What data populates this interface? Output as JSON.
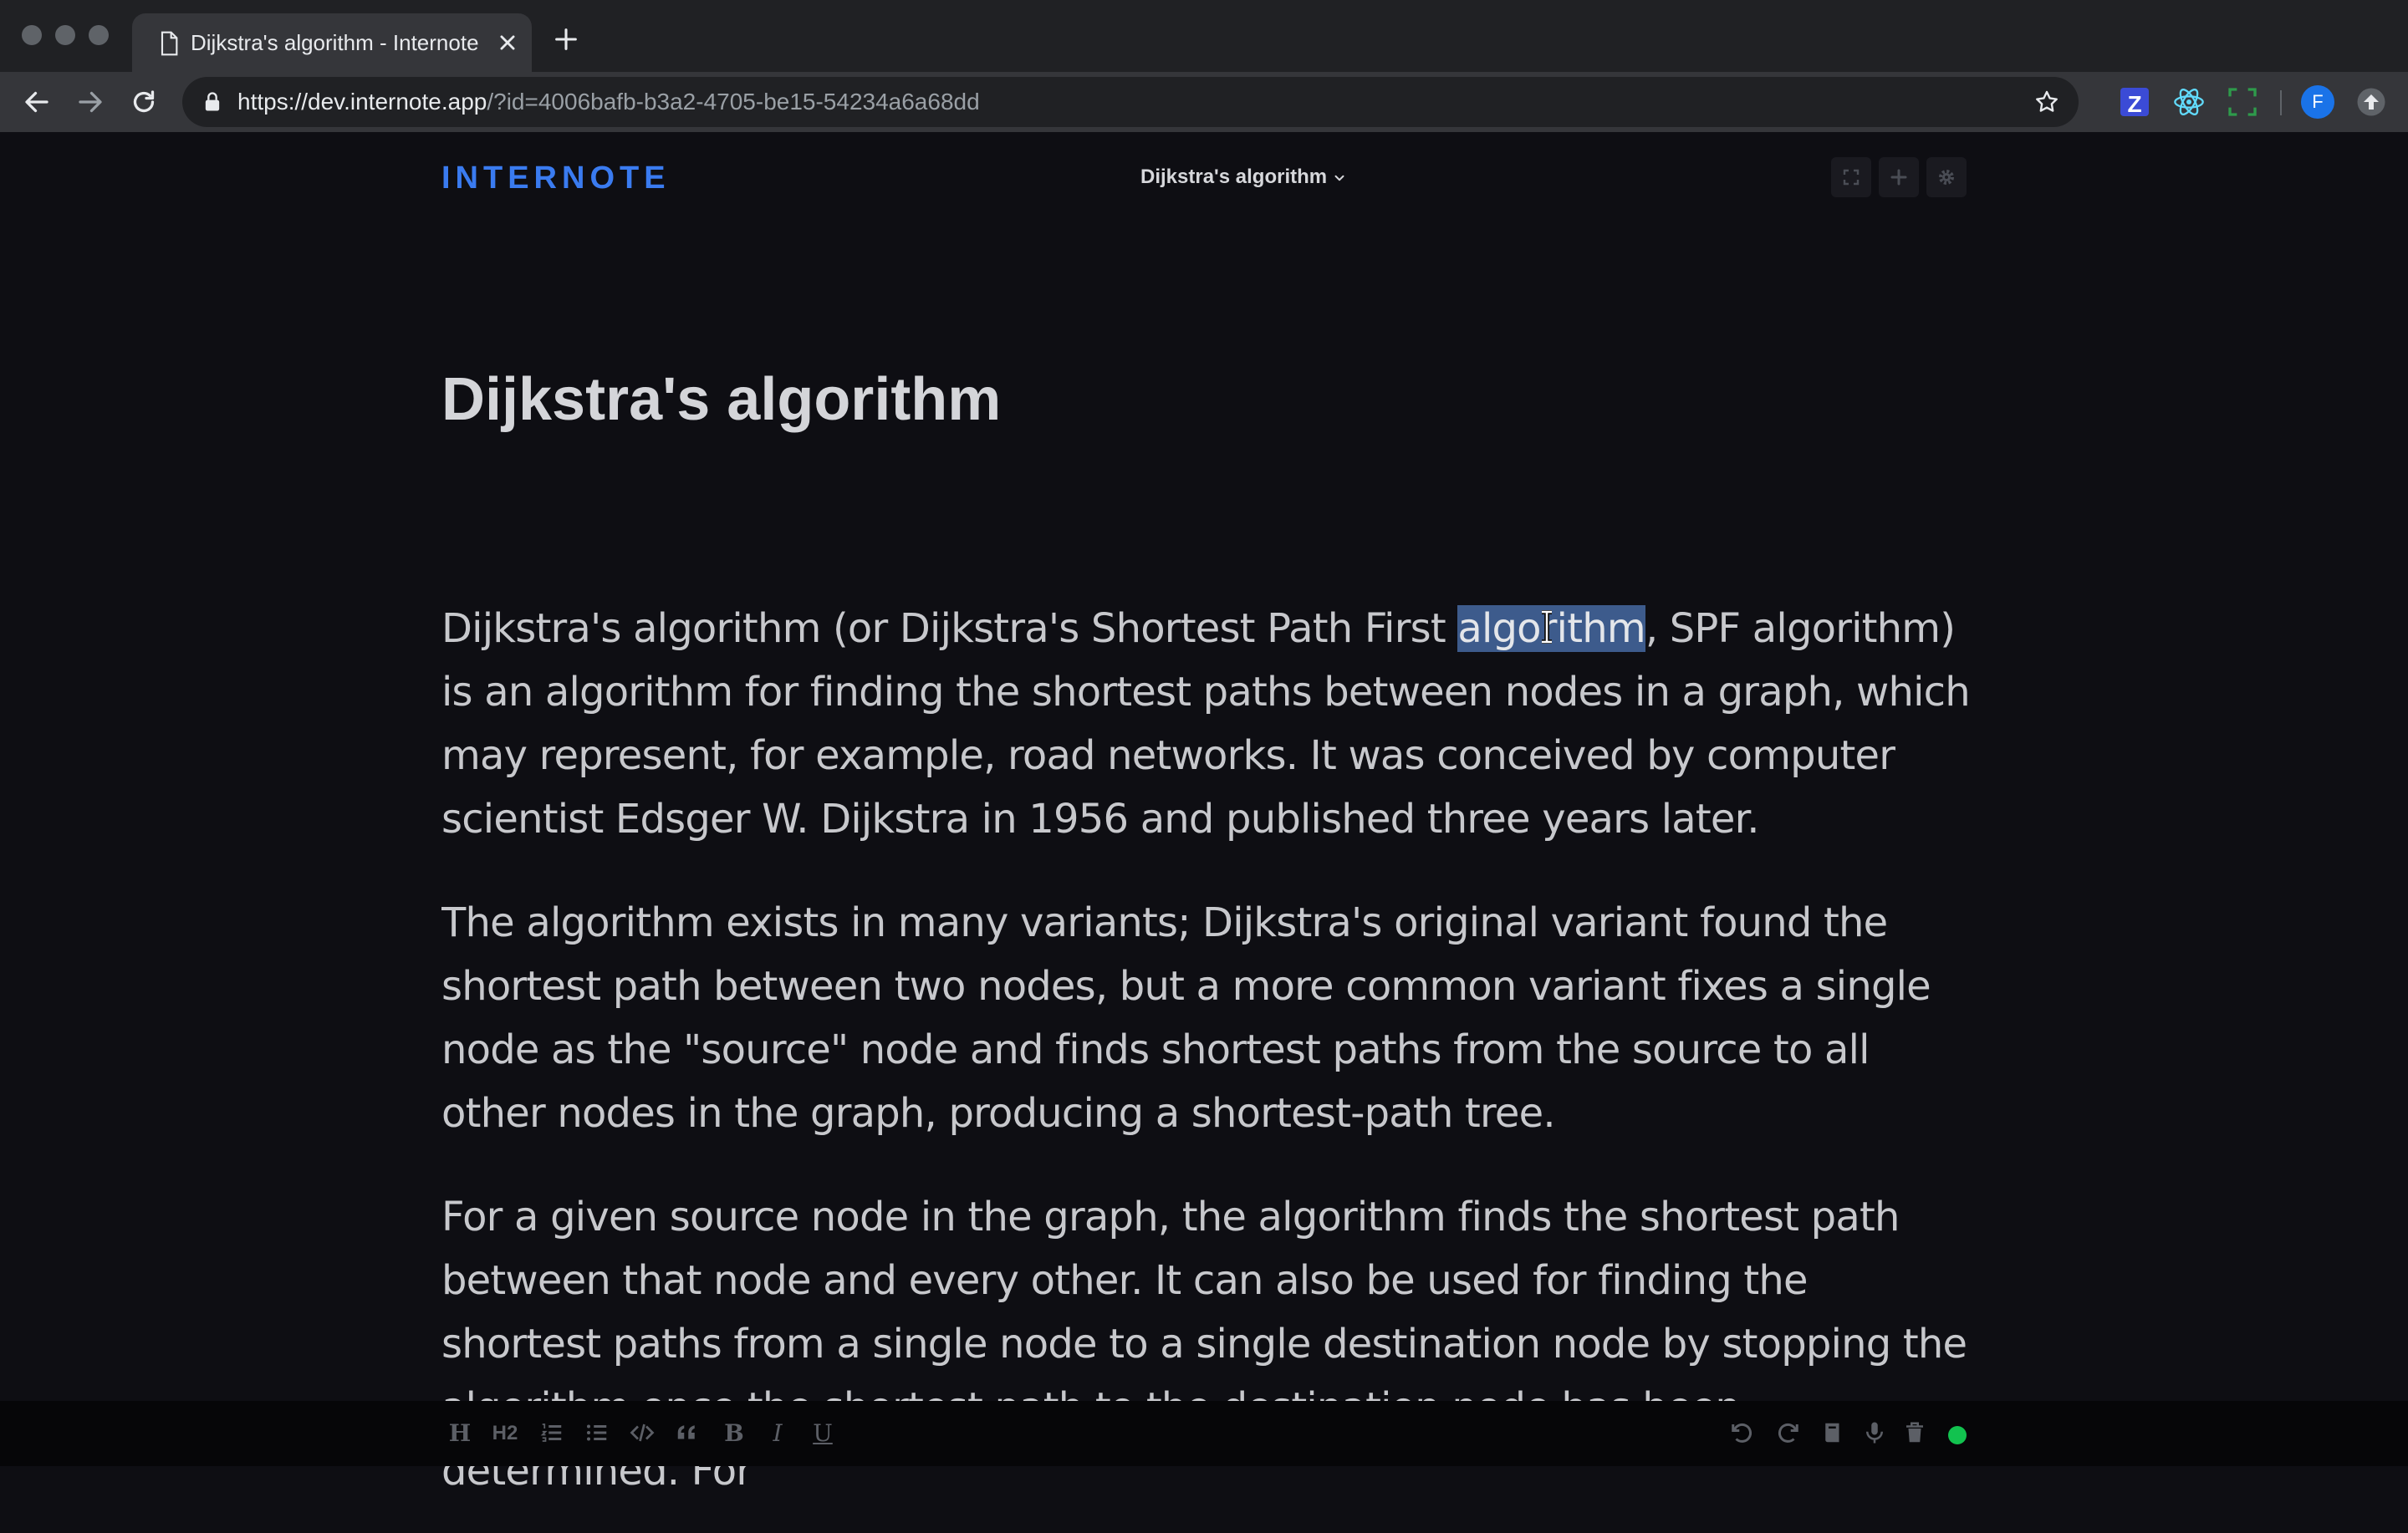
{
  "browser": {
    "tab_title": "Dijkstra's algorithm - Internote",
    "url_host": "https://dev.internote.app",
    "url_path": "/?id=4006bafb-b3a2-4705-be15-54234a6a68dd",
    "extension_z_label": "Z",
    "profile_initial": "F"
  },
  "app": {
    "logo": "INTERNOTE",
    "note_selector_label": "Dijkstra's algorithm",
    "accent_color": "#3a7bf0"
  },
  "document": {
    "title": "Dijkstra's algorithm",
    "p1_before": "Dijkstra's algorithm (or Dijkstra's Shortest Path First ",
    "p1_selected": "algorithm",
    "p1_after": ", SPF algorithm) is an algorithm for finding the shortest paths between nodes in a graph, which may represent, for example, road networks. It was conceived by computer scientist Edsger W. Dijkstra in 1956 and published three years later.",
    "p2": "The algorithm exists in many variants; Dijkstra's original variant found the shortest path between two nodes, but a more common variant fixes a single node as the \"source\" node and finds shortest paths from the source to all other nodes in the graph, producing a shortest-path tree.",
    "p3": "For a given source node in the graph, the algorithm finds the shortest path between that node and every other. It can also be used for finding the shortest paths from a single node to a single destination node by stopping the algorithm once the shortest path to the destination node has been determined. For"
  },
  "format_bar": {
    "heading1": "H",
    "heading2": "H2",
    "bold": "B",
    "italic": "I",
    "underline": "U"
  },
  "status": {
    "color": "#12c24f"
  }
}
